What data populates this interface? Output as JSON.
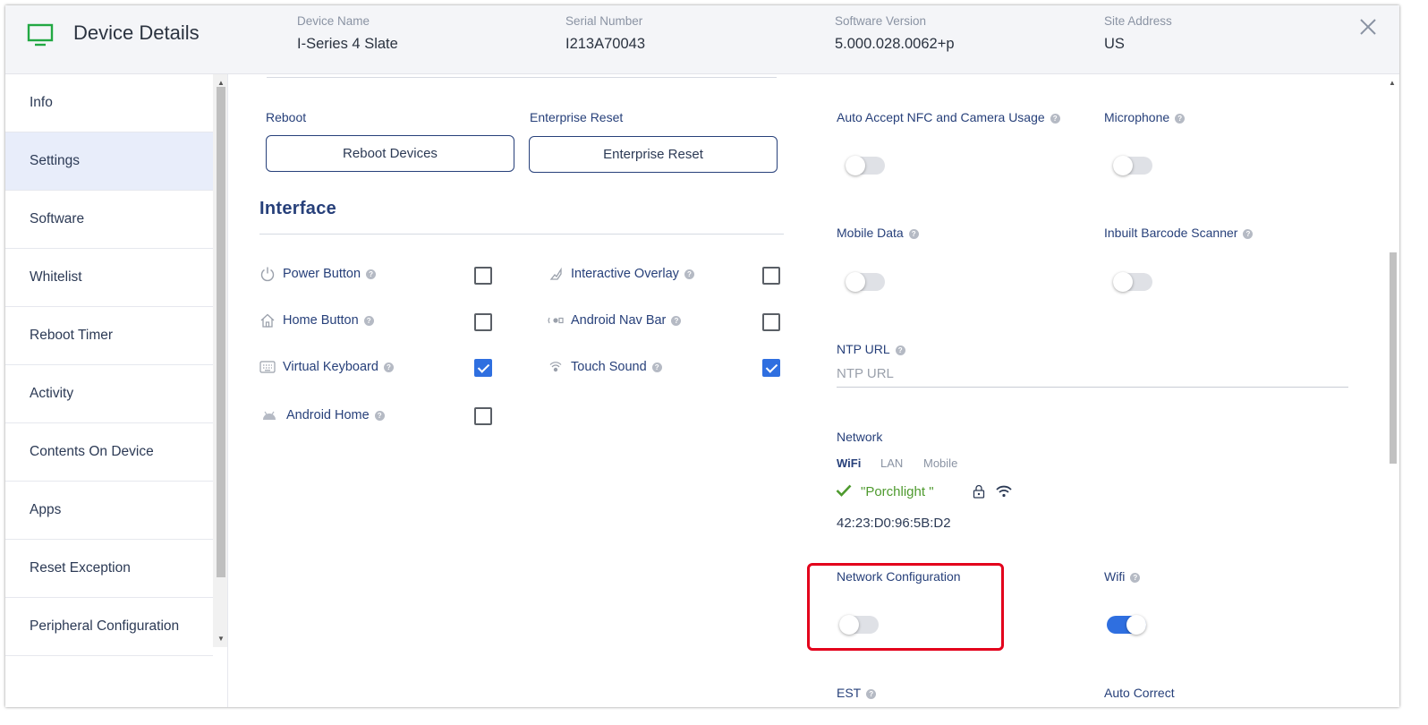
{
  "header": {
    "title": "Device Details",
    "fields": [
      {
        "label": "Device Name",
        "value": "I-Series 4 Slate"
      },
      {
        "label": "Serial Number",
        "value": "I213A70043"
      },
      {
        "label": "Software Version",
        "value": "5.000.028.0062+p"
      },
      {
        "label": "Site Address",
        "value": "US"
      }
    ],
    "monitor_icon_color": "#22a843"
  },
  "sidebar": {
    "items": [
      {
        "label": "Info",
        "active": false
      },
      {
        "label": "Settings",
        "active": true
      },
      {
        "label": "Software",
        "active": false
      },
      {
        "label": "Whitelist",
        "active": false
      },
      {
        "label": "Reboot Timer",
        "active": false
      },
      {
        "label": "Activity",
        "active": false
      },
      {
        "label": "Contents On Device",
        "active": false
      },
      {
        "label": "Apps",
        "active": false
      },
      {
        "label": "Reset Exception",
        "active": false
      },
      {
        "label": "Peripheral Configuration",
        "active": false
      }
    ]
  },
  "reboot": {
    "label": "Reboot",
    "button": "Reboot Devices"
  },
  "enterprise_reset": {
    "label": "Enterprise Reset",
    "button": "Enterprise Reset"
  },
  "interface": {
    "heading": "Interface",
    "options": [
      {
        "label": "Power Button",
        "icon": "power-icon",
        "checked": false
      },
      {
        "label": "Interactive Overlay",
        "icon": "overlay-icon",
        "checked": false
      },
      {
        "label": "Home Button",
        "icon": "home-icon",
        "checked": false
      },
      {
        "label": "Android Nav Bar",
        "icon": "nav-bar-icon",
        "checked": false
      },
      {
        "label": "Virtual Keyboard",
        "icon": "keyboard-icon",
        "checked": true
      },
      {
        "label": "Touch Sound",
        "icon": "sound-icon",
        "checked": true
      },
      {
        "label": "Android Home",
        "icon": "android-icon",
        "checked": false
      }
    ]
  },
  "settings": {
    "auto_accept": {
      "label": "Auto Accept NFC and Camera Usage",
      "on": false
    },
    "microphone": {
      "label": "Microphone",
      "on": false
    },
    "mobile_data": {
      "label": "Mobile Data",
      "on": false
    },
    "barcode": {
      "label": "Inbuilt Barcode Scanner",
      "on": false
    },
    "ntp": {
      "label": "NTP URL",
      "placeholder": "NTP URL"
    },
    "network": {
      "label": "Network",
      "tabs": [
        "WiFi",
        "LAN",
        "Mobile"
      ],
      "active_tab": "WiFi",
      "ssid": "\"Porchlight \"",
      "mac": "42:23:D0:96:5B:D2"
    },
    "network_config": {
      "label": "Network Configuration",
      "on": false
    },
    "wifi": {
      "label": "Wifi",
      "on": true
    },
    "est": {
      "label": "EST"
    },
    "auto_correct": {
      "label": "Auto Correct"
    }
  },
  "colors": {
    "accent": "#2f6fe0",
    "highlight": "#e3001b",
    "connected": "#4e9a2e"
  }
}
